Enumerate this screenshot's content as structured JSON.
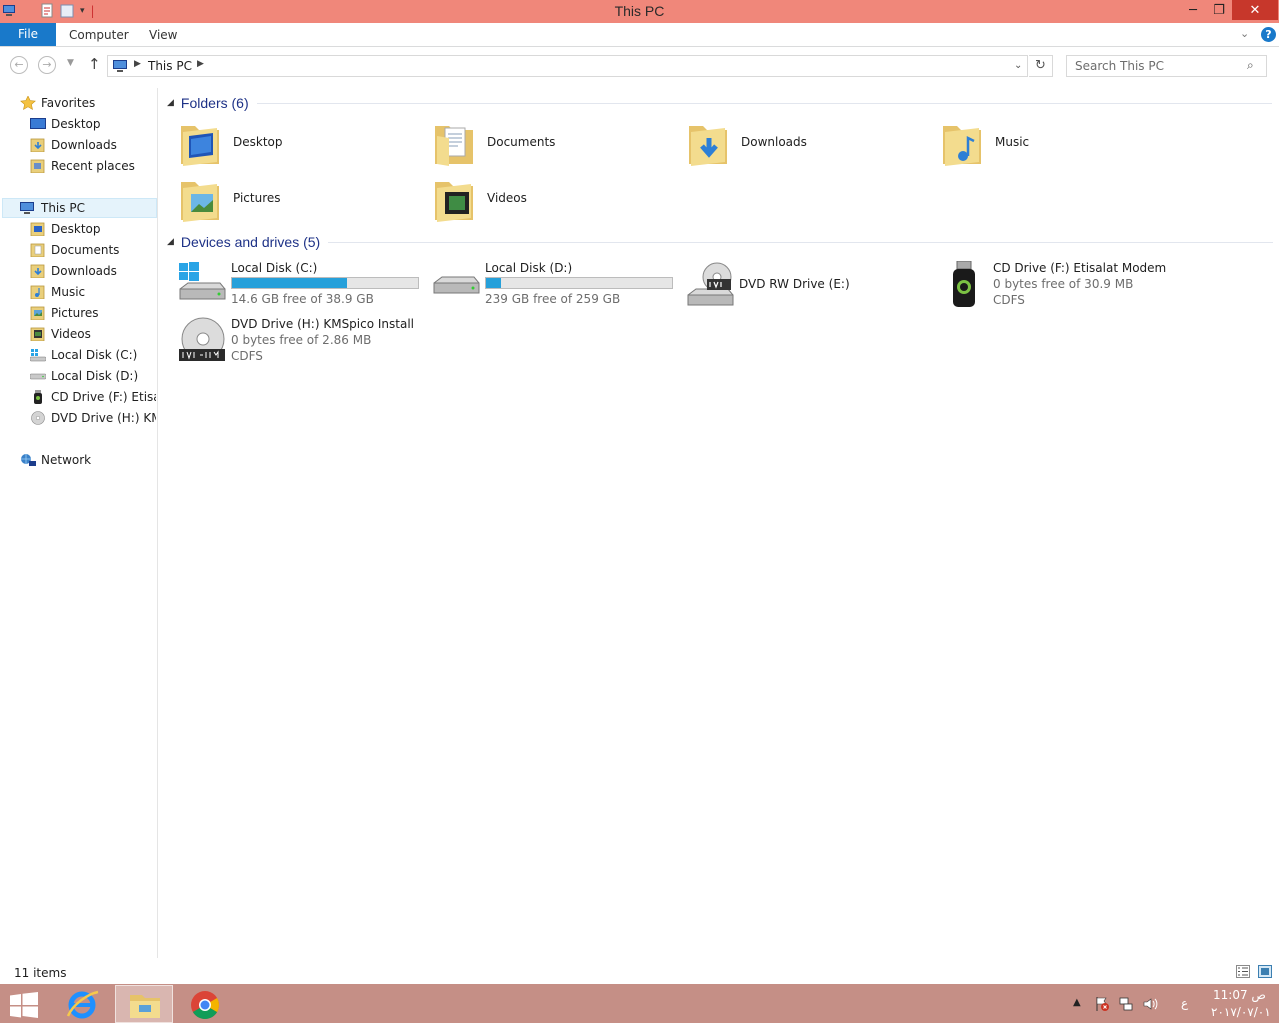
{
  "window": {
    "title": "This PC",
    "controls": {
      "minimize": "─",
      "maximize": "❐",
      "close": "✕"
    }
  },
  "ribbon": {
    "file_tab": "File",
    "tabs": [
      "Computer",
      "View"
    ],
    "help": "?"
  },
  "navigation": {
    "back": "←",
    "forward": "→",
    "up": "↑",
    "address_path": "This PC",
    "refresh": "↻",
    "search_placeholder": "Search This PC"
  },
  "nav_pane": {
    "favorites": {
      "label": "Favorites",
      "items": [
        "Desktop",
        "Downloads",
        "Recent places"
      ]
    },
    "this_pc": {
      "label": "This PC",
      "items": [
        "Desktop",
        "Documents",
        "Downloads",
        "Music",
        "Pictures",
        "Videos",
        "Local Disk (C:)",
        "Local Disk (D:)",
        "CD Drive (F:) Etisalat",
        "DVD Drive (H:) KMSp"
      ]
    },
    "network": {
      "label": "Network"
    }
  },
  "folders": {
    "heading": "Folders (6)",
    "items": [
      "Desktop",
      "Documents",
      "Downloads",
      "Music",
      "Pictures",
      "Videos"
    ]
  },
  "devices": {
    "heading": "Devices and drives (5)",
    "items": [
      {
        "name": "Local Disk (C:)",
        "free": "14.6 GB free of 38.9 GB",
        "used_fraction": 0.62
      },
      {
        "name": "Local Disk (D:)",
        "free": "239 GB free of 259 GB",
        "used_fraction": 0.08
      },
      {
        "name": "DVD RW Drive (E:)"
      },
      {
        "name": "CD Drive (F:) Etisalat Modem",
        "free": "0 bytes free of 30.9 MB",
        "fs": "CDFS"
      },
      {
        "name": "DVD Drive (H:) KMSpico Install",
        "free": "0 bytes free of 2.86 MB",
        "fs": "CDFS"
      }
    ]
  },
  "status": {
    "count": "11 items"
  },
  "taskbar": {
    "time": "11:07 ص",
    "date": "٢٠١٧/٠٧/٠١",
    "lang": "ع"
  },
  "colors": {
    "titlebar": "#f0877a",
    "accent": "#1979ca",
    "taskbar": "#c58f86",
    "drive_fill": "#26a0da",
    "group_heading": "#1e3287"
  }
}
